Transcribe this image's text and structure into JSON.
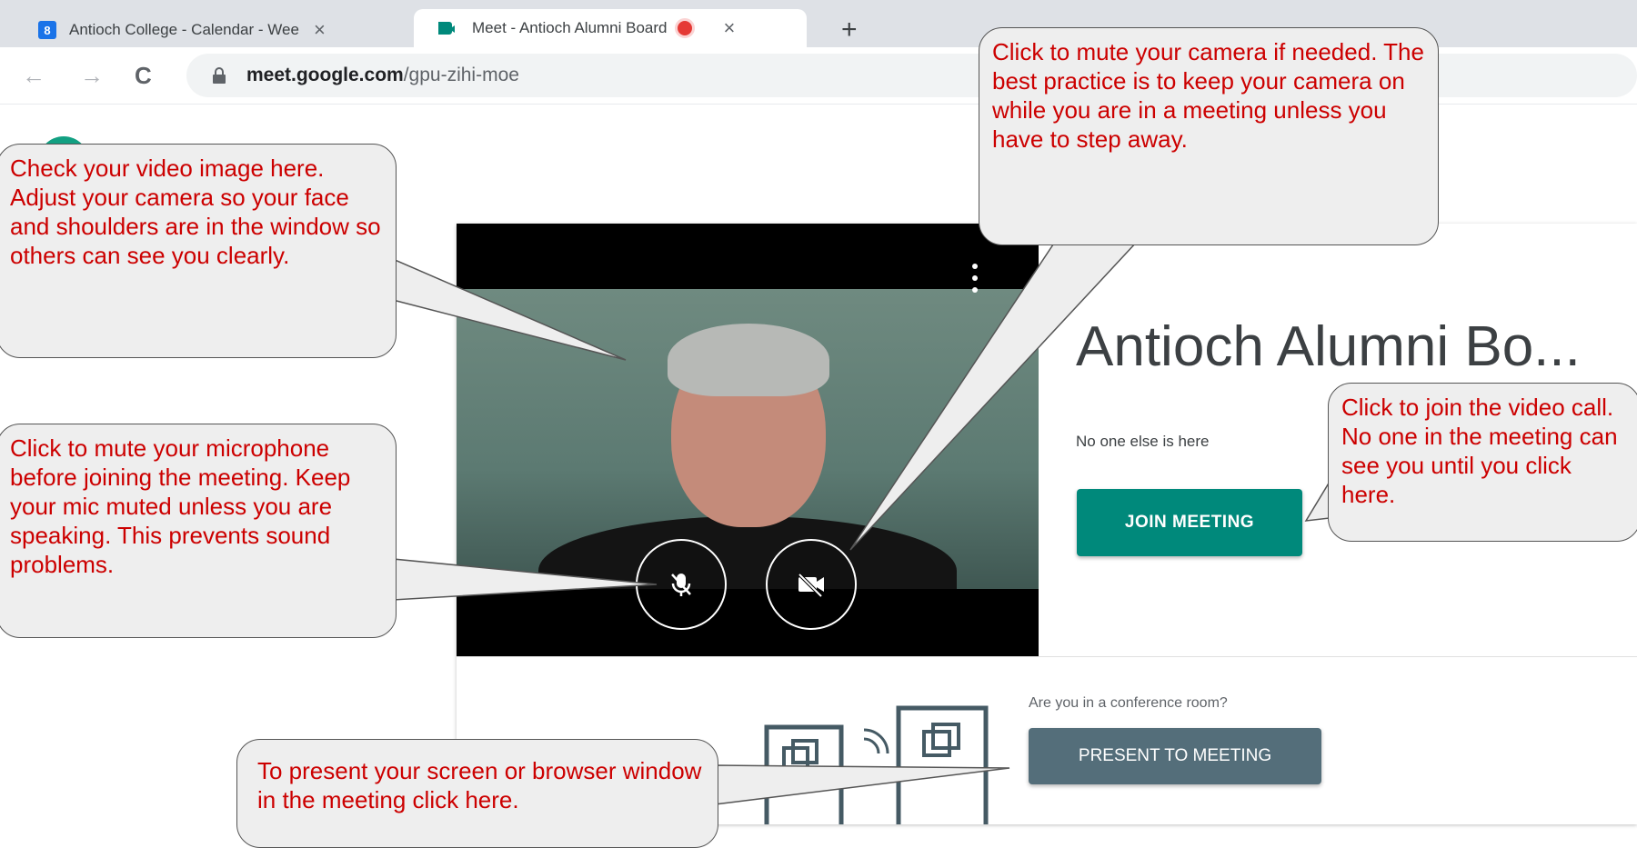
{
  "browser": {
    "tabs": [
      {
        "label": "Antioch College - Calendar - Wee",
        "icon_text": "8",
        "icon": "calendar-icon"
      },
      {
        "label": "Meet - Antioch Alumni Board",
        "icon": "meet-icon"
      }
    ],
    "new_tab_label": "+",
    "close_label": "×",
    "url_host": "meet.google.com",
    "url_path": "/gpu-zihi-moe",
    "back_icon": "←",
    "forward_icon": "→",
    "reload_icon": "C"
  },
  "meeting": {
    "title": "Antioch Alumni Bo...",
    "status": "No one else is here",
    "join_label": "JOIN MEETING",
    "conference_question": "Are you in a conference room?",
    "present_label": "PRESENT TO MEETING"
  },
  "callouts": {
    "video": "Check your video image here. Adjust your camera so your face and shoulders are in the window so others can see you clearly.",
    "mic": "Click to mute your microphone before joining the meeting. Keep your mic muted unless you are speaking. This prevents sound problems.",
    "camera": "Click to mute your camera if needed. The best practice is to keep your camera on while you are in a meeting unless you have to step away.",
    "join": "Click to join the video call. No one in the meeting can see you until you click here.",
    "present": "To present your screen or browser window in the meeting click here."
  },
  "colors": {
    "join": "#00897b",
    "present": "#546e7a",
    "callout_text": "#cc0000",
    "avatar": "#12a082"
  }
}
